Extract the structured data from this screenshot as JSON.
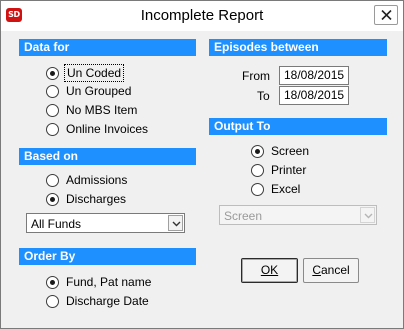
{
  "window": {
    "title": "Incomplete Report",
    "app_icon_text": "SD"
  },
  "data_for": {
    "header": "Data for",
    "options": [
      {
        "label": "Un Coded",
        "checked": true
      },
      {
        "label": "Un Grouped",
        "checked": false
      },
      {
        "label": "No MBS Item",
        "checked": false
      },
      {
        "label": "Online Invoices",
        "checked": false
      }
    ]
  },
  "based_on": {
    "header": "Based on",
    "options": [
      {
        "label": "Admissions",
        "checked": false
      },
      {
        "label": "Discharges",
        "checked": true
      }
    ],
    "fund_select": "All Funds"
  },
  "order_by": {
    "header": "Order By",
    "options": [
      {
        "label": "Fund, Pat name",
        "checked": true
      },
      {
        "label": "Discharge Date",
        "checked": false
      }
    ]
  },
  "episodes": {
    "header": "Episodes between",
    "from_label": "From",
    "from_value": "18/08/2015",
    "to_label": "To",
    "to_value": "18/08/2015"
  },
  "output_to": {
    "header": "Output To",
    "options": [
      {
        "label": "Screen",
        "checked": true
      },
      {
        "label": "Printer",
        "checked": false
      },
      {
        "label": "Excel",
        "checked": false
      }
    ],
    "screen_select": "Screen"
  },
  "buttons": {
    "ok_label": "OK",
    "cancel_hotkey": "C",
    "cancel_rest": "ancel"
  }
}
